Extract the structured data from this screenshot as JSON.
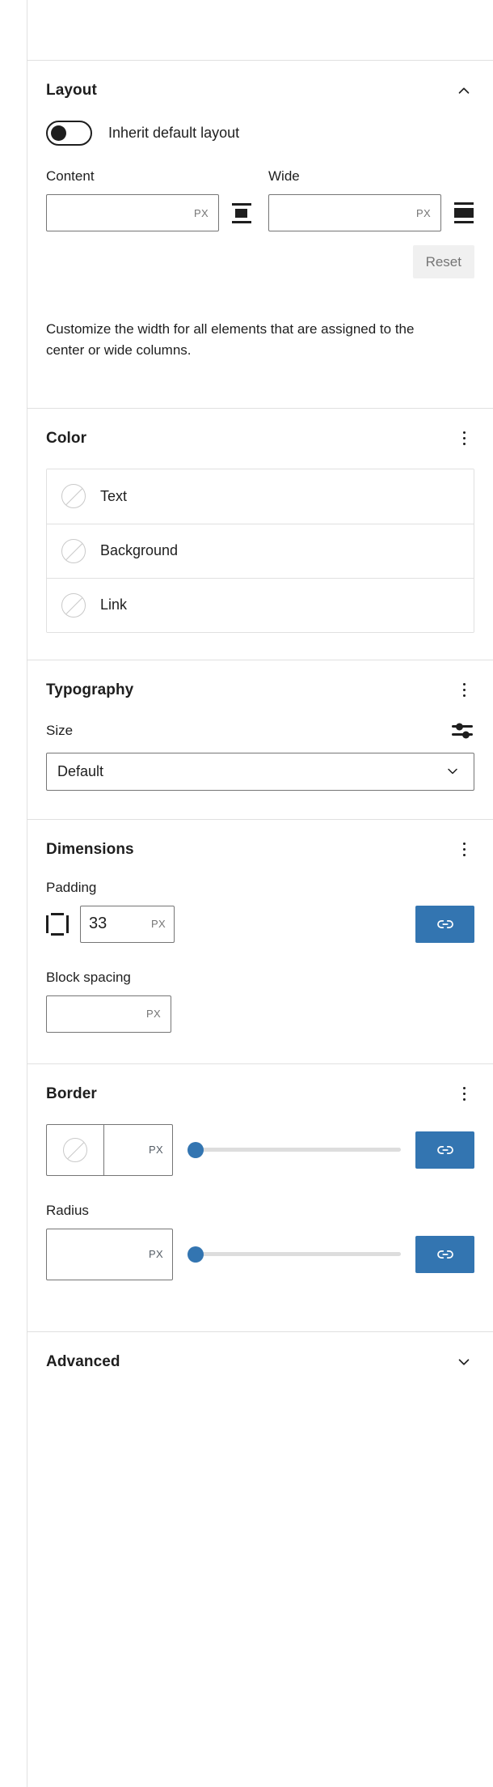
{
  "panels": {
    "layout": {
      "title": "Layout",
      "toggle_label": "Inherit default layout",
      "content_label": "Content",
      "wide_label": "Wide",
      "content_value": "",
      "content_unit": "PX",
      "wide_value": "",
      "wide_unit": "PX",
      "reset_label": "Reset",
      "help_text": "Customize the width for all elements that are assigned to the center or wide columns."
    },
    "color": {
      "title": "Color",
      "items": [
        {
          "label": "Text"
        },
        {
          "label": "Background"
        },
        {
          "label": "Link"
        }
      ]
    },
    "typography": {
      "title": "Typography",
      "size_label": "Size",
      "size_value": "Default"
    },
    "dimensions": {
      "title": "Dimensions",
      "padding_label": "Padding",
      "padding_value": "33",
      "padding_unit": "PX",
      "block_spacing_label": "Block spacing",
      "block_spacing_value": "",
      "block_spacing_unit": "PX"
    },
    "border": {
      "title": "Border",
      "width_value": "",
      "width_unit": "PX",
      "radius_label": "Radius",
      "radius_value": "",
      "radius_unit": "PX"
    },
    "advanced": {
      "title": "Advanced"
    }
  },
  "colors": {
    "accent_blue": "#3375b1",
    "text": "#1e1e1e",
    "muted": "#757575",
    "divider": "#e0e0e0",
    "reset_bg": "#f0f0f0",
    "slider_track": "#dddddd"
  }
}
